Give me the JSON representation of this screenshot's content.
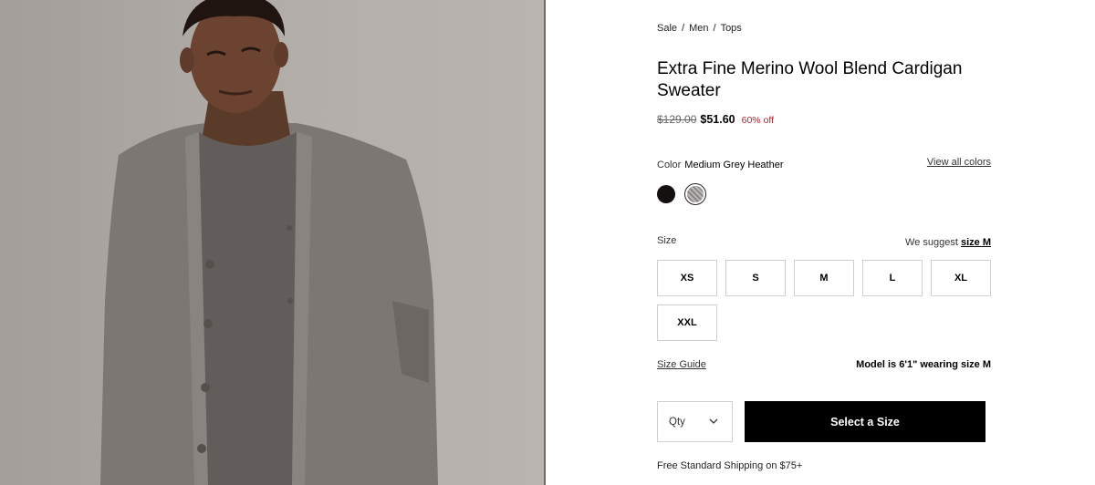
{
  "breadcrumb": [
    "Sale",
    "Men",
    "Tops"
  ],
  "product": {
    "title": "Extra Fine Merino Wool Blend Cardigan Sweater",
    "price_original": "$129.00",
    "price_sale": "$51.60",
    "discount": "60% off"
  },
  "color": {
    "label": "Color",
    "selected": "Medium Grey Heather",
    "view_all": "View all colors",
    "swatches": [
      {
        "name": "Black",
        "hex": "#141010"
      },
      {
        "name": "Medium Grey Heather",
        "hex": "#a3a0a0"
      }
    ]
  },
  "size": {
    "label": "Size",
    "suggest_prefix": "We suggest",
    "suggest_value": "size M",
    "options": [
      "XS",
      "S",
      "M",
      "L",
      "XL",
      "XXL"
    ],
    "guide": "Size Guide",
    "model_info": "Model is 6'1\" wearing size M"
  },
  "cart": {
    "qty_label": "Qty",
    "button": "Select a Size"
  },
  "shipping": "Free Standard Shipping on $75+",
  "colors": {
    "sale_red": "#b4202a",
    "button_bg": "#000000",
    "photo_bg": "#b3aeaa"
  }
}
